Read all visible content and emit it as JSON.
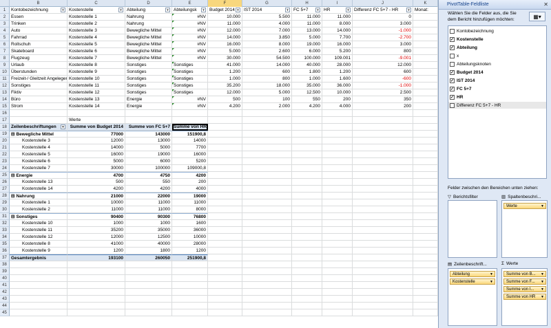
{
  "columns": [
    "B",
    "C",
    "D",
    "E",
    "F",
    "G",
    "H",
    "I",
    "J",
    "K",
    "L"
  ],
  "row_numbers": [
    "1",
    "2",
    "3",
    "4",
    "5",
    "6",
    "7",
    "8",
    "9",
    "10",
    "11",
    "12",
    "13",
    "14",
    "15",
    "16",
    "17",
    "18",
    "19",
    "20",
    "21",
    "22",
    "23",
    "24",
    "25",
    "26",
    "27",
    "28",
    "29",
    "30",
    "31",
    "32",
    "33",
    "34",
    "35",
    "36",
    "37",
    "38",
    "39",
    "40",
    "41",
    "42",
    "43",
    "44",
    "45"
  ],
  "table_headers": {
    "kontobezeichnung": "Kontobezeichnung",
    "kostenstelle": "Kostenstelle",
    "abteilung": "Abteilung",
    "abteilungsk": "Abteilungsk",
    "budget": "Budget 2014",
    "ist": "IST 2014",
    "fc": "FC 5+7",
    "hr": "HR",
    "differenz": "Differenz FC 5+7 - HR",
    "monat": "Monat:"
  },
  "data_rows": [
    {
      "k": "Essen",
      "ks": "Kostenstelle 1",
      "abt": "Nahrung",
      "abk": "#NV",
      "b": "10.000",
      "i": "5.500",
      "fc": "11.000",
      "hr": "11.000",
      "d": "0",
      "neg": false
    },
    {
      "k": "Trinken",
      "ks": "Kostenstelle 2",
      "abt": "Nahrung",
      "abk": "#NV",
      "b": "11.000",
      "i": "4.000",
      "fc": "11.000",
      "hr": "8.000",
      "d": "3.000",
      "neg": false
    },
    {
      "k": "Auto",
      "ks": "Kostenstelle 3",
      "abt": "Bewegliche Mittel",
      "abk": "#NV",
      "b": "12.000",
      "i": "7.000",
      "fc": "13.000",
      "hr": "14.000",
      "d": "-1.000",
      "neg": true
    },
    {
      "k": "Fahrrad",
      "ks": "Kostenstelle 4",
      "abt": "Bewegliche Mittel",
      "abk": "#NV",
      "b": "14.000",
      "i": "3.850",
      "fc": "5.000",
      "hr": "7.700",
      "d": "-2.700",
      "neg": true
    },
    {
      "k": "Rollschuh",
      "ks": "Kostenstelle 5",
      "abt": "Bewegliche Mittel",
      "abk": "#NV",
      "b": "16.000",
      "i": "8.000",
      "fc": "19.000",
      "hr": "16.000",
      "d": "3.000",
      "neg": false
    },
    {
      "k": "Skateboard",
      "ks": "Kostenstelle 6",
      "abt": "Bewegliche Mittel",
      "abk": "#NV",
      "b": "5.000",
      "i": "2.600",
      "fc": "6.000",
      "hr": "5.200",
      "d": "800",
      "neg": false
    },
    {
      "k": "Flugzeug",
      "ks": "Kostenstelle 7",
      "abt": "Bewegliche Mittel",
      "abk": "#NV",
      "b": "30.000",
      "i": "54.500",
      "fc": "100.000",
      "hr": "109.001",
      "d": "-9.001",
      "neg": true
    },
    {
      "k": "Urlaub",
      "ks": "Kostenstelle 8",
      "abt": "Sonstiges",
      "abk": "Sonstiges",
      "b": "41.000",
      "i": "14.000",
      "fc": "40.000",
      "hr": "28.000",
      "d": "12.000",
      "neg": false
    },
    {
      "k": "Überstunden",
      "ks": "Kostenstelle 9",
      "abt": "Sonstiges",
      "abk": "Sonstiges",
      "b": "1.200",
      "i": "600",
      "fc": "1.800",
      "hr": "1.200",
      "d": "600",
      "neg": false
    },
    {
      "k": "Freizeit-/ Gleitzeit Angelegenheiten",
      "ks": "Kostenstelle 10",
      "abt": "Sonstiges",
      "abk": "Sonstiges",
      "b": "1.000",
      "i": "800",
      "fc": "1.000",
      "hr": "1.600",
      "d": "-600",
      "neg": true
    },
    {
      "k": "Sonstiges",
      "ks": "Kostenstelle 11",
      "abt": "Sonstiges",
      "abk": "Sonstiges",
      "b": "35.200",
      "i": "18.000",
      "fc": "35.000",
      "hr": "36.000",
      "d": "-1.000",
      "neg": true
    },
    {
      "k": "Fiktiv",
      "ks": "Kostenstelle 12",
      "abt": "Sonstiges",
      "abk": "Sonstiges",
      "b": "12.000",
      "i": "5.000",
      "fc": "12.500",
      "hr": "10.000",
      "d": "2.500",
      "neg": false
    },
    {
      "k": "Büro",
      "ks": "Kostenstelle 13",
      "abt": "Energie",
      "abk": "#NV",
      "b": "500",
      "i": "100",
      "fc": "550",
      "hr": "200",
      "d": "350",
      "neg": false
    },
    {
      "k": "Strom",
      "ks": "Kostenstelle 14",
      "abt": "Energie",
      "abk": "#NV",
      "b": "4.200",
      "i": "2.000",
      "fc": "4.200",
      "hr": "4.000",
      "d": "200",
      "neg": false
    }
  ],
  "pivot": {
    "werte_label": "Werte",
    "row_label_header": "Zeilenbeschriftungen",
    "col_budget": "Summe von Budget 2014",
    "col_fc": "Summe von FC 5+7",
    "col_hr": "Summe von HR",
    "rows": [
      {
        "label": "Bewegliche Mittel",
        "b": "77000",
        "fc": "143000",
        "hr": "151900,8",
        "group": true
      },
      {
        "label": "Kostenstelle 3",
        "b": "12000",
        "fc": "13000",
        "hr": "14000",
        "group": false
      },
      {
        "label": "Kostenstelle 4",
        "b": "14000",
        "fc": "5000",
        "hr": "7700",
        "group": false
      },
      {
        "label": "Kostenstelle 5",
        "b": "16000",
        "fc": "19000",
        "hr": "16000",
        "group": false
      },
      {
        "label": "Kostenstelle 6",
        "b": "5000",
        "fc": "6000",
        "hr": "5200",
        "group": false
      },
      {
        "label": "Kostenstelle 7",
        "b": "30000",
        "fc": "100000",
        "hr": "109000,8",
        "group": false
      },
      {
        "label": "Energie",
        "b": "4700",
        "fc": "4750",
        "hr": "4200",
        "group": true
      },
      {
        "label": "Kostenstelle 13",
        "b": "500",
        "fc": "550",
        "hr": "200",
        "group": false
      },
      {
        "label": "Kostenstelle 14",
        "b": "4200",
        "fc": "4200",
        "hr": "4000",
        "group": false
      },
      {
        "label": "Nahrung",
        "b": "21000",
        "fc": "22000",
        "hr": "19000",
        "group": true
      },
      {
        "label": "Kostenstelle 1",
        "b": "10000",
        "fc": "11000",
        "hr": "11000",
        "group": false
      },
      {
        "label": "Kostenstelle 2",
        "b": "11000",
        "fc": "11000",
        "hr": "8000",
        "group": false
      },
      {
        "label": "Sonstiges",
        "b": "90400",
        "fc": "90300",
        "hr": "76800",
        "group": true
      },
      {
        "label": "Kostenstelle 10",
        "b": "1000",
        "fc": "1000",
        "hr": "1600",
        "group": false
      },
      {
        "label": "Kostenstelle 11",
        "b": "35200",
        "fc": "35000",
        "hr": "36000",
        "group": false
      },
      {
        "label": "Kostenstelle 12",
        "b": "12000",
        "fc": "12500",
        "hr": "10000",
        "group": false
      },
      {
        "label": "Kostenstelle 8",
        "b": "41000",
        "fc": "40000",
        "hr": "28000",
        "group": false
      },
      {
        "label": "Kostenstelle 9",
        "b": "1200",
        "fc": "1800",
        "hr": "1200",
        "group": false
      }
    ],
    "total": {
      "label": "Gesamtergebnis",
      "b": "193100",
      "fc": "260050",
      "hr": "251900,8"
    }
  },
  "panel": {
    "title": "PivotTable-Feldliste",
    "close": "✕",
    "description": "Wählen Sie die Felder aus, die Sie dem Bericht hinzufügen möchten:",
    "fields": [
      {
        "label": "Kontobezeichnung",
        "checked": false
      },
      {
        "label": "Kostenstelle",
        "checked": true
      },
      {
        "label": "Abteilung",
        "checked": true
      },
      {
        "label": "x",
        "checked": false
      },
      {
        "label": "Abteilungsknoten",
        "checked": false
      },
      {
        "label": "Budget 2014",
        "checked": true
      },
      {
        "label": "IST 2014",
        "checked": true
      },
      {
        "label": "FC 5+7",
        "checked": true
      },
      {
        "label": "HR",
        "checked": true
      },
      {
        "label": "Differenz FC 5+7 - HR",
        "checked": false
      }
    ],
    "areas_label": "Felder zwischen den Bereichen unten ziehen:",
    "berichtsfilter": "Berichtsfilter",
    "spaltenbeschriftungen": "Spaltenbeschri...",
    "zeilenbeschriftungen": "Zeilenbeschrift...",
    "werte": "Werte",
    "col_tags": [
      "Werte"
    ],
    "row_tags": [
      "Abteilung",
      "Kostenstelle"
    ],
    "value_tags": [
      "Summe von B...",
      "Summe von F...",
      "Summe von I...",
      "Summe von HR"
    ]
  }
}
